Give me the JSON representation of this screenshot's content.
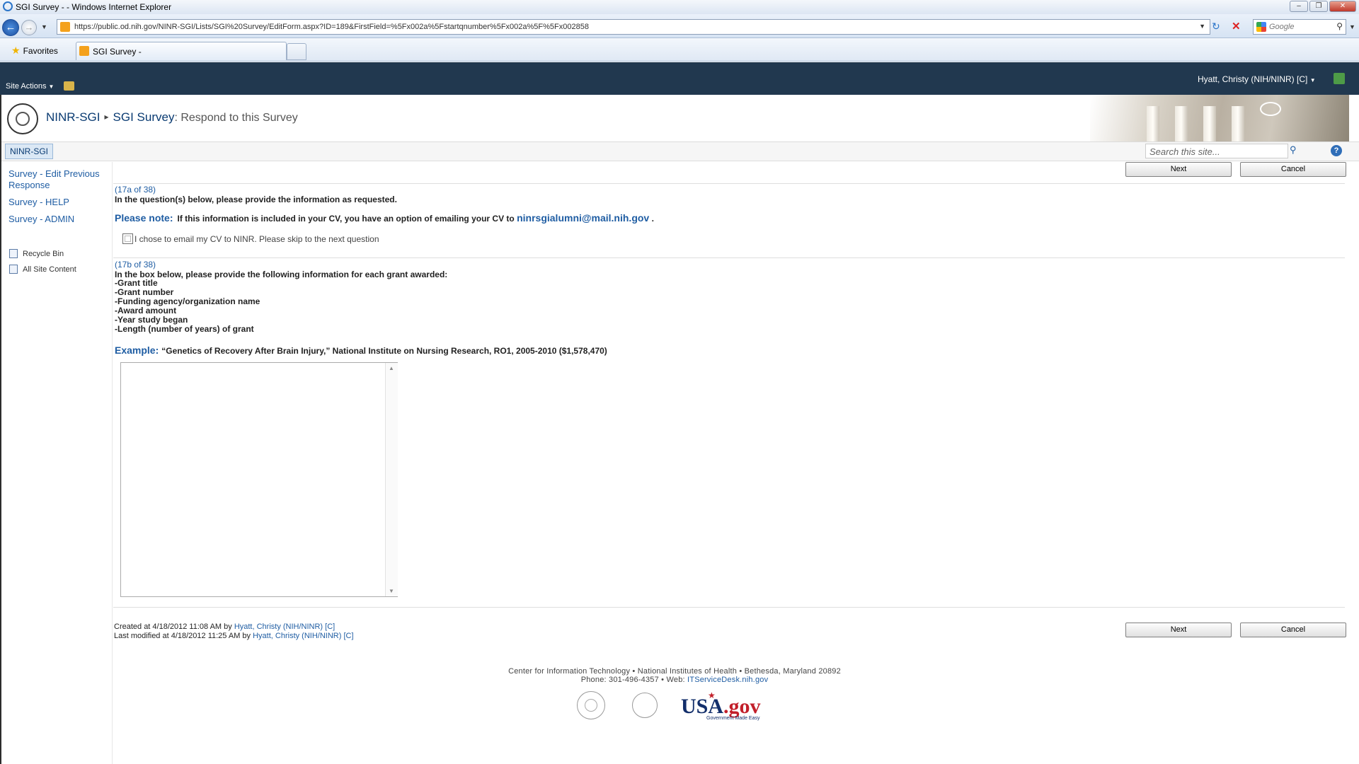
{
  "window": {
    "title": "SGI Survey - - Windows Internet Explorer",
    "controls": [
      "minimize",
      "restore",
      "close"
    ]
  },
  "browser": {
    "url": "https://public.od.nih.gov/NINR-SGI/Lists/SGI%20Survey/EditForm.aspx?ID=189&FirstField=%5Fx002a%5Fstartqnumber%5Fx002a%5F%5Fx002858",
    "search_placeholder": "Google",
    "favorites_label": "Favorites",
    "tab_label": "SGI Survey -"
  },
  "ribbon": {
    "site_actions": "Site Actions",
    "user": "Hyatt, Christy (NIH/NINR) [C]"
  },
  "header": {
    "site": "NINR-SGI",
    "list": "SGI Survey",
    "page": ": Respond to this Survey"
  },
  "topnav": {
    "home": "NINR-SGI",
    "search_placeholder": "Search this site..."
  },
  "leftnav": {
    "links": [
      "Survey - Edit Previous Response",
      "Survey - HELP",
      "Survey - ADMIN"
    ],
    "recycle_bin": "Recycle Bin",
    "all_site_content": "All Site Content"
  },
  "form": {
    "next_label": "Next",
    "cancel_label": "Cancel",
    "q17a": {
      "number": "(17a of 38)",
      "instruction": "In the question(s) below, please provide the information as requested.",
      "note_label": "Please note:",
      "note_text": "If this information is included in your CV, you have an option of emailing your CV to",
      "note_email": "ninrsgialumni@mail.nih.gov",
      "note_end": ".",
      "checkbox_label": "I chose to email my CV to NINR. Please skip to the next question"
    },
    "q17b": {
      "number": "(17b of 38)",
      "instruction": "In the box below, please provide the following information for each grant awarded:",
      "items": [
        "-Grant title",
        "-Grant number",
        "-Funding agency/organization name",
        "-Award amount",
        "-Year study began",
        "-Length (number of years) of grant"
      ],
      "example_label": "Example:",
      "example_text": "“Genetics of Recovery After Brain Injury,” National Institute on Nursing Research, RO1, 2005-2010 ($1,578,470)"
    },
    "created": {
      "prefix": "Created at 4/18/2012 11:08 AM  by",
      "user": "Hyatt, Christy (NIH/NINR) [C]"
    },
    "modified": {
      "prefix": "Last modified at 4/18/2012 11:25 AM  by",
      "user": "Hyatt, Christy (NIH/NINR) [C]"
    }
  },
  "footer": {
    "line1": "Center for Information Technology • National Institutes of Health • Bethesda, Maryland 20892",
    "phone": "Phone: 301-496-4357 • Web:",
    "web": "ITServiceDesk.nih.gov",
    "usa_a": "USA",
    "usa_b": ".gov",
    "usa_tag": "Government Made Easy"
  }
}
